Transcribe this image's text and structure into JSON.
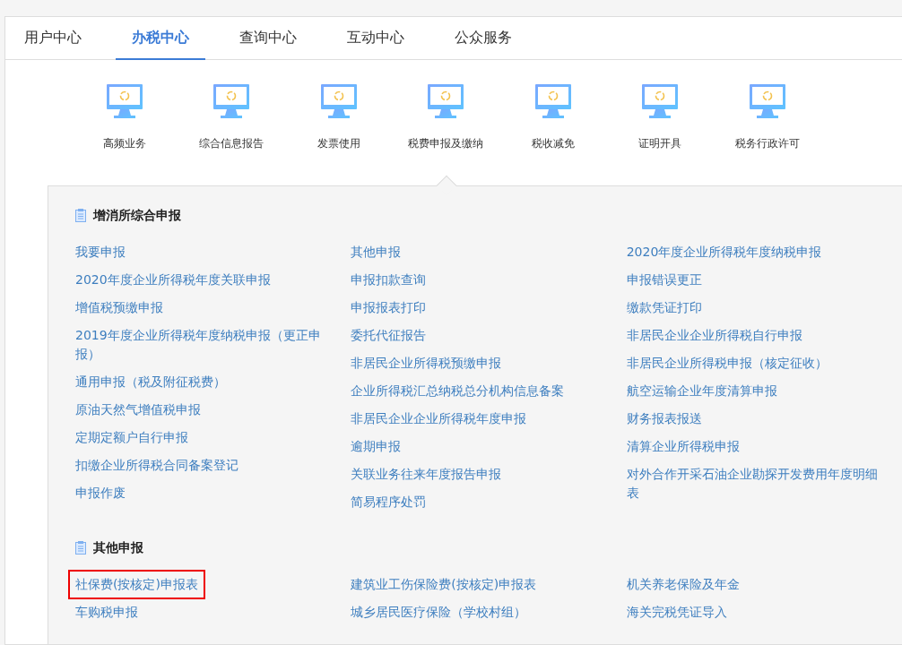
{
  "tabs": [
    {
      "label": "用户中心",
      "selected": false
    },
    {
      "label": "办税中心",
      "selected": true
    },
    {
      "label": "查询中心",
      "selected": false
    },
    {
      "label": "互动中心",
      "selected": false
    },
    {
      "label": "公众服务",
      "selected": false
    }
  ],
  "categories": [
    {
      "label": "高频业务",
      "selected": false
    },
    {
      "label": "综合信息报告",
      "selected": false
    },
    {
      "label": "发票使用",
      "selected": false
    },
    {
      "label": "税费申报及缴纳",
      "selected": true
    },
    {
      "label": "税收减免",
      "selected": false
    },
    {
      "label": "证明开具",
      "selected": false
    },
    {
      "label": "税务行政许可",
      "selected": false
    }
  ],
  "sections": [
    {
      "title": "增消所综合申报",
      "columns": [
        [
          {
            "label": "我要申报",
            "highlighted": false
          },
          {
            "label": "2020年度企业所得税年度关联申报",
            "highlighted": false
          },
          {
            "label": "增值税预缴申报",
            "highlighted": false
          },
          {
            "label": "2019年度企业所得税年度纳税申报（更正申报）",
            "highlighted": false
          },
          {
            "label": "通用申报（税及附征税费）",
            "highlighted": false
          },
          {
            "label": "原油天然气增值税申报",
            "highlighted": false
          },
          {
            "label": "定期定额户自行申报",
            "highlighted": false
          },
          {
            "label": "扣缴企业所得税合同备案登记",
            "highlighted": false
          },
          {
            "label": "申报作废",
            "highlighted": false
          }
        ],
        [
          {
            "label": "其他申报",
            "highlighted": false
          },
          {
            "label": "申报扣款查询",
            "highlighted": false
          },
          {
            "label": "申报报表打印",
            "highlighted": false
          },
          {
            "label": "委托代征报告",
            "highlighted": false
          },
          {
            "label": "非居民企业所得税预缴申报",
            "highlighted": false
          },
          {
            "label": "企业所得税汇总纳税总分机构信息备案",
            "highlighted": false
          },
          {
            "label": "非居民企业企业所得税年度申报",
            "highlighted": false
          },
          {
            "label": "逾期申报",
            "highlighted": false
          },
          {
            "label": "关联业务往来年度报告申报",
            "highlighted": false
          },
          {
            "label": "简易程序处罚",
            "highlighted": false
          }
        ],
        [
          {
            "label": "2020年度企业所得税年度纳税申报",
            "highlighted": false
          },
          {
            "label": "申报错误更正",
            "highlighted": false
          },
          {
            "label": "缴款凭证打印",
            "highlighted": false
          },
          {
            "label": "非居民企业企业所得税自行申报",
            "highlighted": false
          },
          {
            "label": "非居民企业所得税申报（核定征收）",
            "highlighted": false
          },
          {
            "label": "航空运输企业年度清算申报",
            "highlighted": false
          },
          {
            "label": "财务报表报送",
            "highlighted": false
          },
          {
            "label": "清算企业所得税申报",
            "highlighted": false
          },
          {
            "label": "对外合作开采石油企业勘探开发费用年度明细表",
            "highlighted": false
          }
        ]
      ]
    },
    {
      "title": "其他申报",
      "columns": [
        [
          {
            "label": "社保费(按核定)申报表",
            "highlighted": true
          },
          {
            "label": "车购税申报",
            "highlighted": false
          }
        ],
        [
          {
            "label": "建筑业工伤保险费(按核定)申报表",
            "highlighted": false
          },
          {
            "label": "城乡居民医疗保险（学校村组）",
            "highlighted": false
          }
        ],
        [
          {
            "label": "机关养老保险及年金",
            "highlighted": false
          },
          {
            "label": "海关完税凭证导入",
            "highlighted": false
          }
        ]
      ]
    }
  ]
}
